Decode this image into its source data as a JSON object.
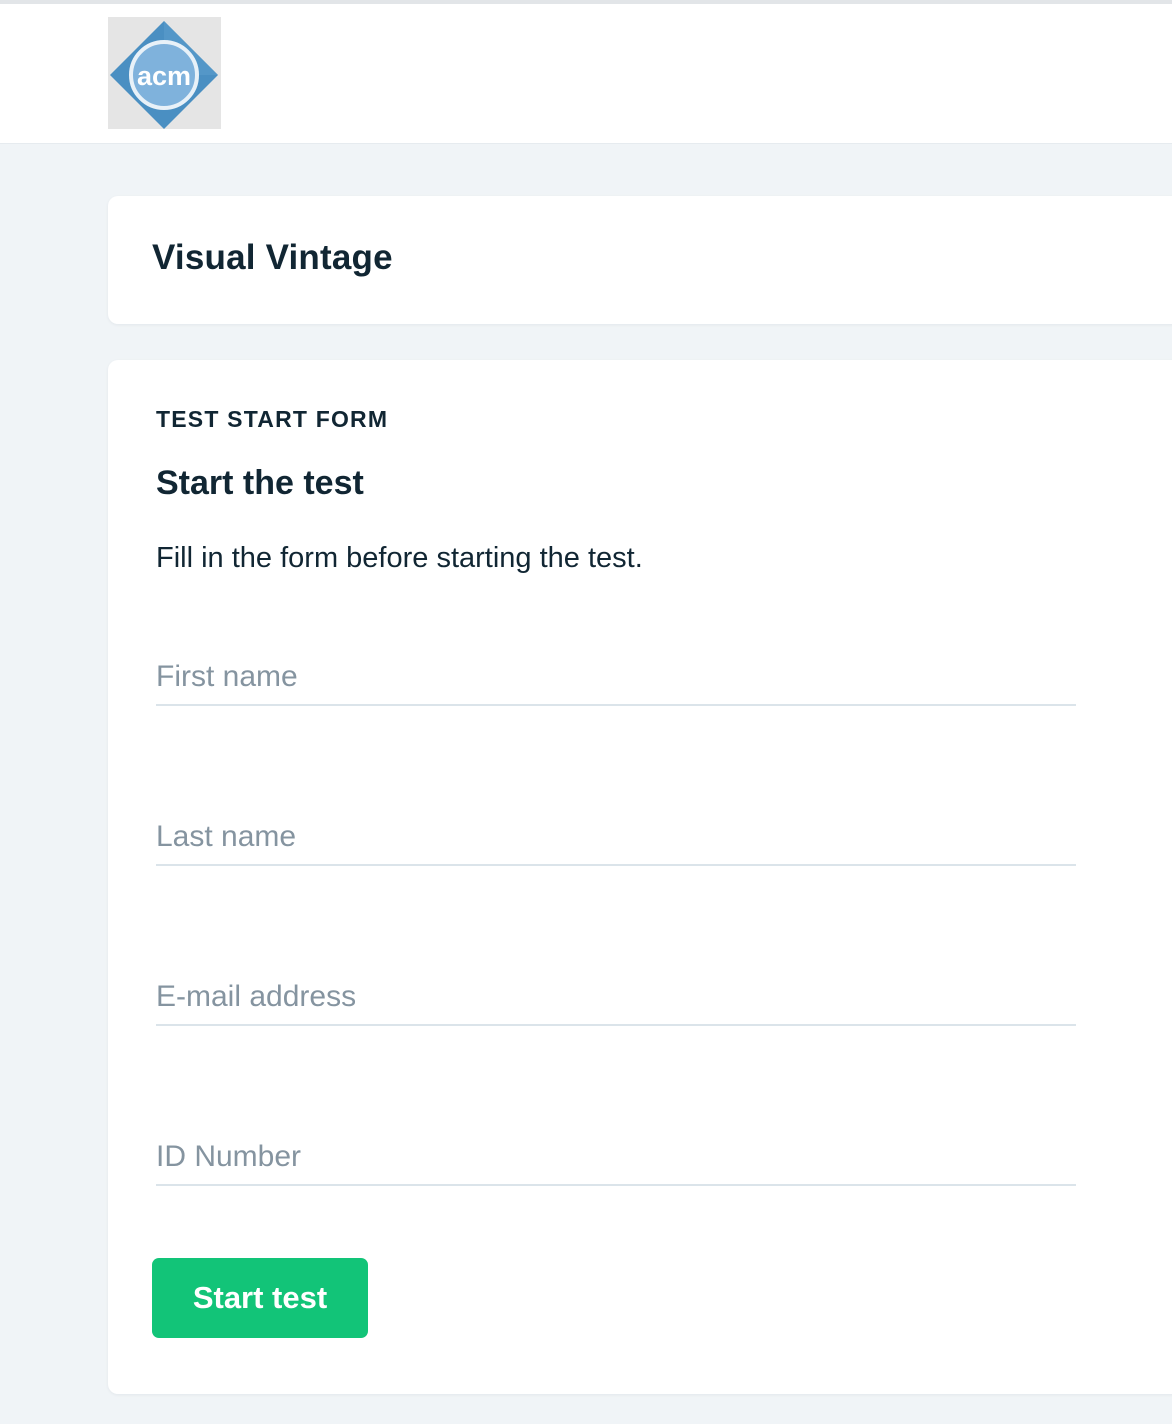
{
  "header": {
    "logo_text": "acm",
    "logo_colors": {
      "diamond": "#4a8fc2",
      "circle": "#6ea7d6",
      "background": "#e5e5e5"
    }
  },
  "title_card": {
    "title": "Visual Vintage"
  },
  "form": {
    "eyebrow": "TEST START FORM",
    "heading": "Start the test",
    "description": "Fill in the form before starting the test.",
    "fields": [
      {
        "placeholder": "First name",
        "value": ""
      },
      {
        "placeholder": "Last name",
        "value": ""
      },
      {
        "placeholder": "E-mail address",
        "value": ""
      },
      {
        "placeholder": "ID Number",
        "value": ""
      }
    ],
    "submit_label": "Start test"
  },
  "colors": {
    "accent_button": "#12c478",
    "page_background": "#f0f4f7",
    "text_primary": "#112633",
    "placeholder": "#8594a0"
  }
}
